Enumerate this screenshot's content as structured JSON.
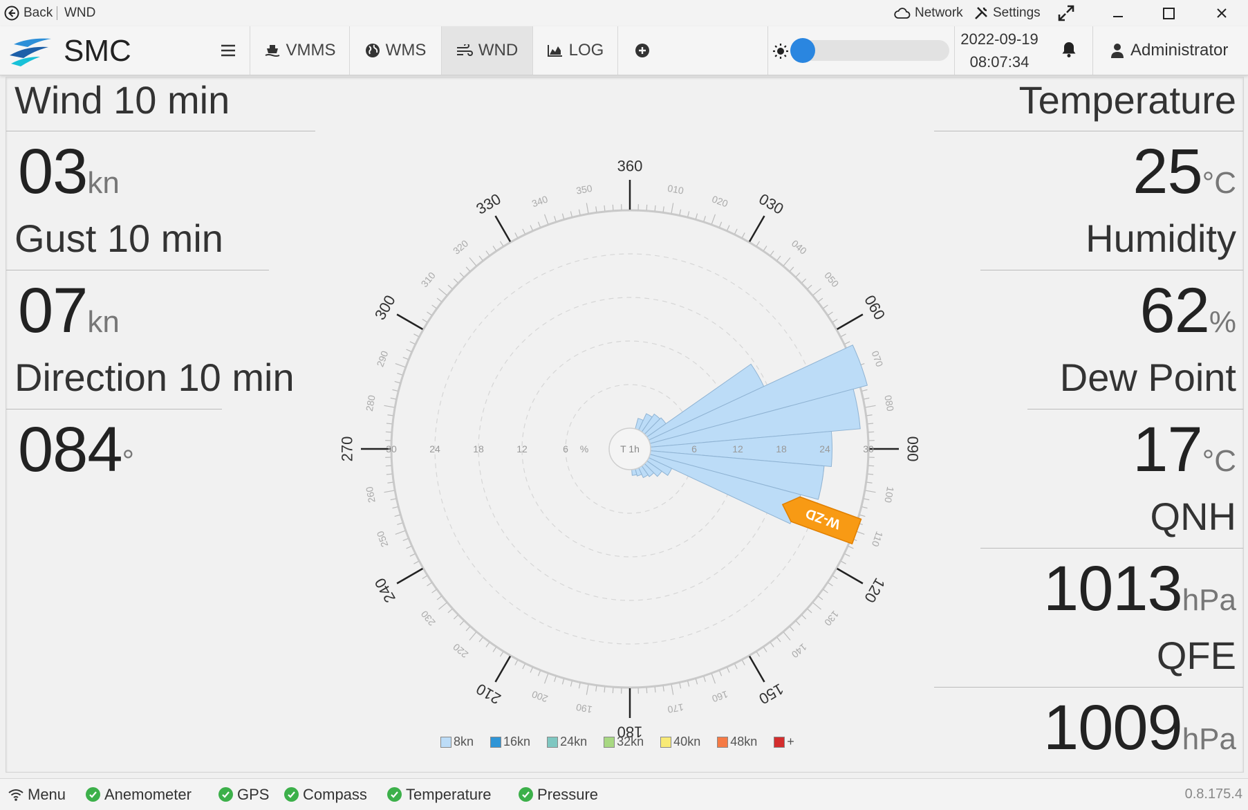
{
  "titlebar": {
    "back_label": "Back",
    "page_label": "WND",
    "network_label": "Network",
    "settings_label": "Settings"
  },
  "toolbar": {
    "brand": "SMC",
    "tabs": [
      {
        "label": "VMMS",
        "icon": "ship-icon"
      },
      {
        "label": "WMS",
        "icon": "globe-icon"
      },
      {
        "label": "WND",
        "icon": "wind-icon",
        "active": true
      },
      {
        "label": "LOG",
        "icon": "area-chart-icon"
      }
    ],
    "add_icon": "plus-circle-icon",
    "brightness_fraction": 0.02,
    "date": "2022-09-19",
    "time": "08:07:34",
    "user": "Administrator"
  },
  "left_panel": {
    "wind_label": "Wind 10 min",
    "wind_value": "03",
    "wind_unit": "kn",
    "gust_label": "Gust 10 min",
    "gust_value": "07",
    "gust_unit": "kn",
    "direction_label": "Direction 10 min",
    "direction_value": "084",
    "direction_unit": "°"
  },
  "right_panel": {
    "temperature_label": "Temperature",
    "temperature_value": "25",
    "temperature_unit": "°C",
    "humidity_label": "Humidity",
    "humidity_value": "62",
    "humidity_unit": "%",
    "dewpoint_label": "Dew Point",
    "dewpoint_value": "17",
    "dewpoint_unit": "°C",
    "qnh_label": "QNH",
    "qnh_value": "1013",
    "qnh_unit": "hPa",
    "qfe_label": "QFE",
    "qfe_value": "1009",
    "qfe_unit": "hPa"
  },
  "rose": {
    "center_label": "T 1h",
    "percent_label": "%",
    "needle_label": "W-ZD",
    "needle_direction_deg": 110,
    "pct_ticks": [
      "6",
      "12",
      "18",
      "24",
      "30"
    ],
    "major_labels": [
      "360",
      "030",
      "060",
      "090",
      "120",
      "150",
      "180",
      "210",
      "240",
      "270",
      "300",
      "330"
    ],
    "minor_labels": [
      "010",
      "020",
      "040",
      "050",
      "070",
      "080",
      "100",
      "110",
      "130",
      "140",
      "160",
      "170",
      "190",
      "200",
      "220",
      "230",
      "250",
      "260",
      "280",
      "290",
      "310",
      "320",
      "340",
      "350"
    ]
  },
  "chart_data": {
    "type": "bar",
    "title": "",
    "radial_axis_range": [
      0,
      30
    ],
    "radial_ticks": [
      6,
      12,
      18,
      24,
      30
    ],
    "direction_step_deg": 10,
    "series": [
      {
        "name": "8kn",
        "color": "#bcdcf7",
        "values": [
          {
            "dir": 20,
            "value": 1.5
          },
          {
            "dir": 30,
            "value": 2.5
          },
          {
            "dir": 40,
            "value": 3.0
          },
          {
            "dir": 50,
            "value": 3.2
          },
          {
            "dir": 60,
            "value": 17.5
          },
          {
            "dir": 70,
            "value": 31.0
          },
          {
            "dir": 80,
            "value": 29.0
          },
          {
            "dir": 90,
            "value": 25.0
          },
          {
            "dir": 100,
            "value": 24.0
          },
          {
            "dir": 110,
            "value": 21.5
          },
          {
            "dir": 120,
            "value": 3.5
          },
          {
            "dir": 130,
            "value": 2.5
          },
          {
            "dir": 140,
            "value": 1.8
          },
          {
            "dir": 150,
            "value": 1.5
          },
          {
            "dir": 160,
            "value": 1.0
          },
          {
            "dir": 170,
            "value": 0.8
          }
        ]
      },
      {
        "name": "16kn",
        "color": "#2f95d6",
        "values": []
      },
      {
        "name": "24kn",
        "color": "#7fc7c1",
        "values": []
      },
      {
        "name": "32kn",
        "color": "#a8d882",
        "values": []
      },
      {
        "name": "40kn",
        "color": "#f8ea76",
        "values": []
      },
      {
        "name": "48kn",
        "color": "#f57a45",
        "values": []
      },
      {
        "name": "+",
        "color": "#d42d2d",
        "values": []
      }
    ]
  },
  "statusbar": {
    "menu_label": "Menu",
    "items": [
      "Anemometer",
      "GPS",
      "Compass",
      "Temperature",
      "Pressure"
    ],
    "version": "0.8.175.4"
  }
}
